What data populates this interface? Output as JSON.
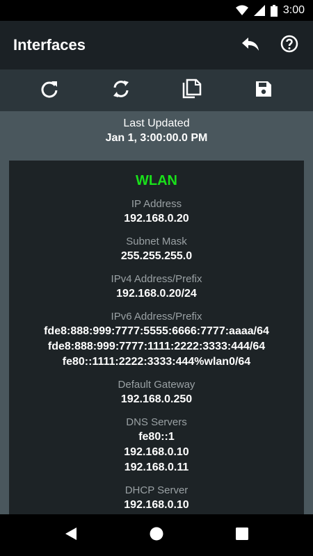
{
  "status_bar": {
    "time": "3:00"
  },
  "app_bar": {
    "title": "Interfaces"
  },
  "last_updated": {
    "label": "Last Updated",
    "value": "Jan 1, 3:00:00.0 PM"
  },
  "interface": {
    "name": "WLAN",
    "name_color": "#19e01a",
    "fields": [
      {
        "label": "IP Address",
        "values": [
          "192.168.0.20"
        ]
      },
      {
        "label": "Subnet Mask",
        "values": [
          "255.255.255.0"
        ]
      },
      {
        "label": "IPv4 Address/Prefix",
        "values": [
          "192.168.0.20/24"
        ]
      },
      {
        "label": "IPv6 Address/Prefix",
        "values": [
          "fde8:888:999:7777:5555:6666:7777:aaaa/64",
          "fde8:888:999:7777:1111:2222:3333:444/64",
          "fe80::1111:2222:3333:444%wlan0/64"
        ]
      },
      {
        "label": "Default Gateway",
        "values": [
          "192.168.0.250"
        ]
      },
      {
        "label": "DNS Servers",
        "values": [
          "fe80::1",
          "192.168.0.10",
          "192.168.0.11"
        ]
      },
      {
        "label": "DHCP Server",
        "values": [
          "192.168.0.10"
        ]
      }
    ]
  }
}
